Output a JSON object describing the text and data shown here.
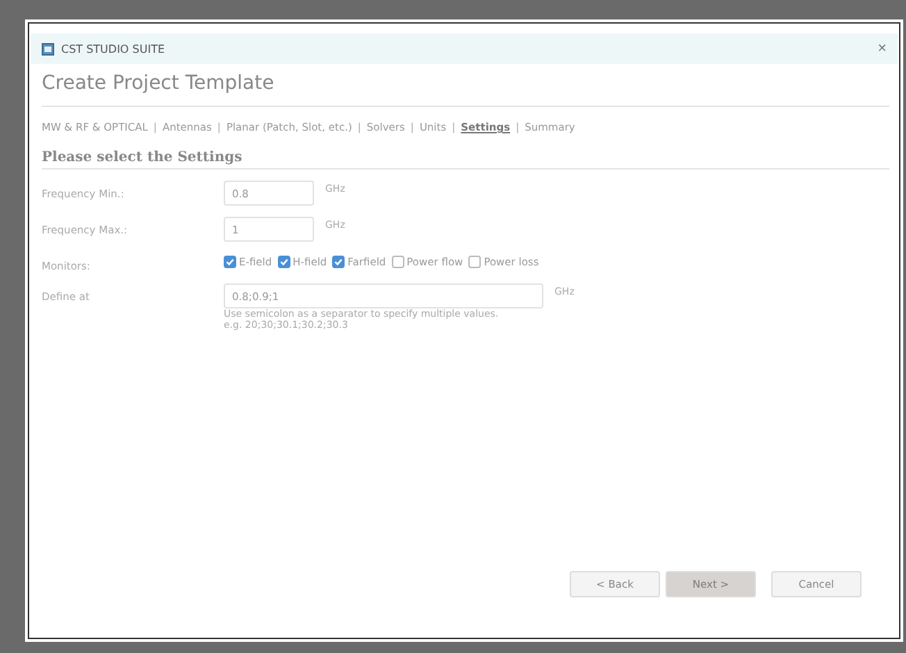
{
  "window": {
    "title": "CST STUDIO SUITE",
    "close": "×"
  },
  "heading": "Create Project Template",
  "breadcrumb": [
    {
      "label": "MW & RF & OPTICAL",
      "selected": false
    },
    {
      "label": "Antennas",
      "selected": false
    },
    {
      "label": "Planar (Patch, Slot, etc.)",
      "selected": false
    },
    {
      "label": "Solvers",
      "selected": false
    },
    {
      "label": "Units",
      "selected": false
    },
    {
      "label": "Settings",
      "selected": true
    },
    {
      "label": "Summary",
      "selected": false
    }
  ],
  "breadcrumb_separator": "|",
  "section_title": "Please select the Settings",
  "freq_min": {
    "label": "Frequency Min.:",
    "value": "0.8",
    "unit": "GHz"
  },
  "freq_max": {
    "label": "Frequency Max.:",
    "value": "1",
    "unit": "GHz"
  },
  "monitors": {
    "label": "Monitors:",
    "options": [
      {
        "label": "E-field",
        "checked": true
      },
      {
        "label": "H-field",
        "checked": true
      },
      {
        "label": "Farfield",
        "checked": true
      },
      {
        "label": "Power flow",
        "checked": false
      },
      {
        "label": "Power loss",
        "checked": false
      }
    ]
  },
  "define_at": {
    "label": "Define at",
    "value": "0.8;0.9;1",
    "unit": "GHz",
    "hint": "Use semicolon as a separator to specify multiple values.",
    "example": "e.g. 20;30;30.1;30.2;30.3"
  },
  "buttons": [
    {
      "label": "< Back",
      "disabled": false
    },
    {
      "label": "Next >",
      "disabled": true
    },
    {
      "label": "Cancel",
      "disabled": false
    }
  ]
}
